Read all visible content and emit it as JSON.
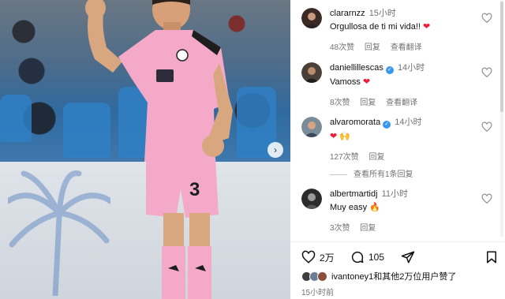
{
  "photo": {
    "alt_icon": "carousel-next-icon",
    "next_glyph": "›",
    "jersey_number": "3"
  },
  "comments": [
    {
      "username": "clararnzz",
      "verified": false,
      "time": "15小时",
      "text": "Orgullosa de ti mi vida!!",
      "emoji": "❤",
      "likes": "48次赞",
      "reply": "回复",
      "translate": "查看翻译",
      "avatar_color": "#3a2a26"
    },
    {
      "username": "daniellillescas",
      "verified": true,
      "time": "14小时",
      "text": "Vamoss",
      "emoji": "❤",
      "likes": "8次赞",
      "reply": "回复",
      "translate": "查看翻译",
      "avatar_color": "#4a4038"
    },
    {
      "username": "alvaromorata",
      "verified": true,
      "time": "14小时",
      "text": "",
      "emoji": "❤ 🙌",
      "likes": "127次赞",
      "reply": "回复",
      "translate": "",
      "avatar_color": "#7a8c9a"
    },
    {
      "username": "albertmartidj",
      "verified": false,
      "time": "11小时",
      "text": "Muy easy",
      "emoji": "🔥",
      "likes": "3次赞",
      "reply": "回复",
      "translate": "",
      "avatar_color": "#2b2b2b"
    }
  ],
  "view_replies": "查看所有1条回复",
  "actions": {
    "like_count": "2万",
    "comment_count": "105"
  },
  "likes_summary": "ivantoney1和其他2万位用户赞了",
  "post_time": "15小时前",
  "colors": {
    "jersey_pink": "#f4a9c8",
    "verified_blue": "#3897f0",
    "heart_red": "#ed1c3a",
    "meta_gray": "#737373"
  }
}
